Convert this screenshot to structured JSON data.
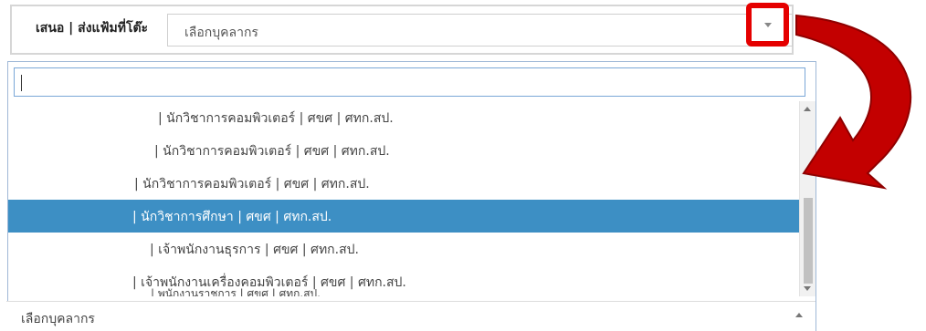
{
  "top_form": {
    "label": "เสนอ | ส่งแฟ้มที่โต๊ะ",
    "select_value": "เลือกบุคลากร"
  },
  "dropdown": {
    "search_value": "",
    "items": [
      "| นักวิชาการคอมพิวเตอร์ | ศขศ | ศทก.สป.",
      "| นักวิชาการคอมพิวเตอร์ | ศขศ | ศทก.สป.",
      "| นักวิชาการคอมพิวเตอร์ | ศขศ | ศทก.สป.",
      "| นักวิชาการศึกษา | ศขศ | ศทก.สป.",
      "| เจ้าพนักงานธุรการ | ศขศ | ศทก.สป.",
      "| เจ้าพนักงานเครื่องคอมพิวเตอร์ | ศขศ | ศทก.สป.",
      "| พนักงานราชการ | ศขศ | ศทก.สป."
    ],
    "active_index": 3
  },
  "bottom_field": {
    "label": "เลือกบุคลากร"
  },
  "colors": {
    "highlight_border": "#e50000",
    "arrow": "#c30000",
    "active_row": "#3d8fc4"
  }
}
